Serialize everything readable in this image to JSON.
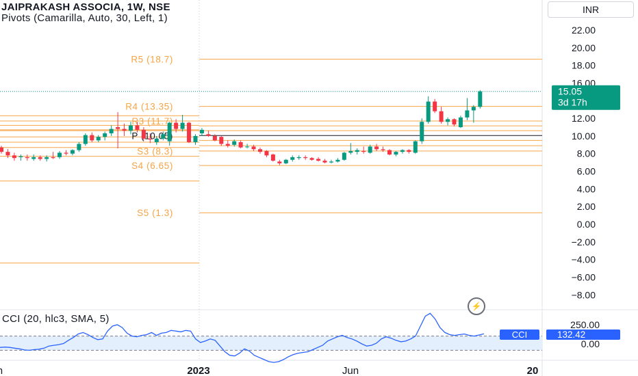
{
  "header": {
    "title": "JAIPRAKASH ASSOCIA, 1W, NSE",
    "subtitle": "Pivots (Camarilla, Auto, 30, Left, 1)",
    "currency": "INR"
  },
  "price_axis": {
    "ticks": [
      "22.00",
      "20.00",
      "18.00",
      "16.00",
      "14.00",
      "12.00",
      "10.00",
      "8.00",
      "6.00",
      "4.00",
      "2.00",
      "0.00",
      "−2.00",
      "−4.00",
      "−6.00",
      "−8.00"
    ],
    "last_price": "15.05",
    "countdown": "3d 17h",
    "last_color": "#089981"
  },
  "time_axis": {
    "labels": [
      "Jun",
      "2023",
      "Jun",
      "20"
    ]
  },
  "cci": {
    "title": "CCI (20, hlc3, SMA, 5)",
    "ticks": [
      "250.00",
      "0.00"
    ],
    "badge_label": "CCI",
    "badge_value": "132.42",
    "line_color": "#2962ff"
  },
  "flash_icon": "lightning-icon",
  "colors": {
    "up": "#089981",
    "down": "#f23645",
    "pivot": "#f7a446",
    "grid_text": "#131722"
  },
  "chart_data": {
    "type": "candlestick",
    "title": "JAIPRAKASH ASSOCIA, 1W, NSE",
    "ylim": [
      -9.2,
      23.6
    ],
    "pivot_levels_current": [
      {
        "label": "R5 (18.7)",
        "value": 18.7
      },
      {
        "label": "R4 (13.35)",
        "value": 13.35
      },
      {
        "label": "R3 (11.7)",
        "value": 11.7
      },
      {
        "label": "S4 (6.65)",
        "value": 6.65
      },
      {
        "label": "S3 (8.3)",
        "value": 8.3
      },
      {
        "label": "S5 (1.3)",
        "value": 1.3
      },
      {
        "label": "P (10.05)",
        "value": 10.05
      }
    ],
    "pivot_levels_current_unlabeled": [
      11.15,
      10.6,
      9.5,
      8.9
    ],
    "pivot_levels_previous": [
      12.3,
      11.7,
      11.2,
      10.6,
      10.7,
      9.9,
      9.3,
      8.7,
      7.7,
      4.9,
      -4.4
    ],
    "candles": [
      {
        "o": 8.7,
        "h": 8.9,
        "l": 8.0,
        "c": 8.2
      },
      {
        "o": 8.2,
        "h": 8.5,
        "l": 7.5,
        "c": 7.8
      },
      {
        "o": 7.8,
        "h": 8.1,
        "l": 7.2,
        "c": 7.5
      },
      {
        "o": 7.6,
        "h": 7.9,
        "l": 7.2,
        "c": 7.7
      },
      {
        "o": 7.6,
        "h": 7.9,
        "l": 7.2,
        "c": 7.5
      },
      {
        "o": 7.4,
        "h": 7.9,
        "l": 7.2,
        "c": 7.6
      },
      {
        "o": 7.6,
        "h": 7.8,
        "l": 7.2,
        "c": 7.4
      },
      {
        "o": 7.4,
        "h": 7.8,
        "l": 7.1,
        "c": 7.6
      },
      {
        "o": 7.6,
        "h": 8.2,
        "l": 7.4,
        "c": 7.5
      },
      {
        "o": 7.6,
        "h": 8.3,
        "l": 7.4,
        "c": 8.1
      },
      {
        "o": 8.1,
        "h": 8.4,
        "l": 7.8,
        "c": 8.0
      },
      {
        "o": 8.0,
        "h": 8.5,
        "l": 7.8,
        "c": 8.4
      },
      {
        "o": 8.4,
        "h": 9.3,
        "l": 8.2,
        "c": 9.1
      },
      {
        "o": 9.1,
        "h": 10.3,
        "l": 8.9,
        "c": 10.1
      },
      {
        "o": 10.1,
        "h": 10.4,
        "l": 9.3,
        "c": 9.5
      },
      {
        "o": 9.5,
        "h": 10.1,
        "l": 9.3,
        "c": 9.9
      },
      {
        "o": 9.9,
        "h": 10.5,
        "l": 9.5,
        "c": 10.3
      },
      {
        "o": 10.3,
        "h": 11.2,
        "l": 10.0,
        "c": 10.8
      },
      {
        "o": 11.0,
        "h": 12.7,
        "l": 8.6,
        "c": 10.8
      },
      {
        "o": 10.8,
        "h": 11.4,
        "l": 10.0,
        "c": 10.6
      },
      {
        "o": 10.6,
        "h": 11.6,
        "l": 10.2,
        "c": 11.2
      },
      {
        "o": 11.2,
        "h": 11.6,
        "l": 10.4,
        "c": 10.7
      },
      {
        "o": 10.7,
        "h": 11.0,
        "l": 9.5,
        "c": 9.7
      },
      {
        "o": 9.7,
        "h": 10.3,
        "l": 9.2,
        "c": 9.6
      },
      {
        "o": 9.3,
        "h": 10.0,
        "l": 9.0,
        "c": 9.7
      },
      {
        "o": 9.7,
        "h": 10.5,
        "l": 9.5,
        "c": 10.2
      },
      {
        "o": 9.4,
        "h": 11.6,
        "l": 8.9,
        "c": 11.5
      },
      {
        "o": 11.5,
        "h": 11.9,
        "l": 10.4,
        "c": 10.8
      },
      {
        "o": 10.8,
        "h": 12.4,
        "l": 10.5,
        "c": 11.5
      },
      {
        "o": 11.5,
        "h": 11.6,
        "l": 9.2,
        "c": 9.3
      },
      {
        "o": 9.3,
        "h": 10.2,
        "l": 9.0,
        "c": 10.0
      },
      {
        "o": 10.3,
        "h": 10.9,
        "l": 10.0,
        "c": 10.7
      },
      {
        "o": 10.2,
        "h": 10.6,
        "l": 9.9,
        "c": 10.0
      },
      {
        "o": 10.0,
        "h": 10.2,
        "l": 9.4,
        "c": 9.5
      },
      {
        "o": 9.9,
        "h": 10.0,
        "l": 8.9,
        "c": 9.1
      },
      {
        "o": 9.1,
        "h": 9.5,
        "l": 8.7,
        "c": 8.9
      },
      {
        "o": 9.0,
        "h": 9.6,
        "l": 8.8,
        "c": 9.4
      },
      {
        "o": 9.3,
        "h": 9.5,
        "l": 8.6,
        "c": 8.7
      },
      {
        "o": 8.8,
        "h": 9.1,
        "l": 8.6,
        "c": 8.8
      },
      {
        "o": 8.8,
        "h": 9.0,
        "l": 8.3,
        "c": 8.5
      },
      {
        "o": 8.5,
        "h": 8.7,
        "l": 8.0,
        "c": 8.2
      },
      {
        "o": 8.3,
        "h": 8.4,
        "l": 7.6,
        "c": 7.8
      },
      {
        "o": 7.9,
        "h": 8.0,
        "l": 7.1,
        "c": 7.2
      },
      {
        "o": 7.1,
        "h": 7.3,
        "l": 6.7,
        "c": 6.9
      },
      {
        "o": 6.9,
        "h": 7.4,
        "l": 6.8,
        "c": 7.3
      },
      {
        "o": 7.3,
        "h": 7.8,
        "l": 7.1,
        "c": 7.6
      },
      {
        "o": 7.5,
        "h": 7.8,
        "l": 7.3,
        "c": 7.6
      },
      {
        "o": 7.6,
        "h": 7.8,
        "l": 7.3,
        "c": 7.5
      },
      {
        "o": 7.5,
        "h": 7.6,
        "l": 7.2,
        "c": 7.3
      },
      {
        "o": 7.4,
        "h": 7.6,
        "l": 7.1,
        "c": 7.2
      },
      {
        "o": 7.2,
        "h": 7.4,
        "l": 6.9,
        "c": 7.0
      },
      {
        "o": 7.0,
        "h": 7.3,
        "l": 6.9,
        "c": 7.1
      },
      {
        "o": 7.1,
        "h": 7.5,
        "l": 7.0,
        "c": 7.3
      },
      {
        "o": 7.3,
        "h": 8.2,
        "l": 7.2,
        "c": 8.1
      },
      {
        "o": 8.1,
        "h": 9.2,
        "l": 7.9,
        "c": 8.3
      },
      {
        "o": 8.2,
        "h": 8.6,
        "l": 7.9,
        "c": 8.4
      },
      {
        "o": 8.3,
        "h": 8.8,
        "l": 8.0,
        "c": 8.2
      },
      {
        "o": 8.1,
        "h": 9.0,
        "l": 8.0,
        "c": 8.8
      },
      {
        "o": 8.8,
        "h": 9.1,
        "l": 8.3,
        "c": 8.5
      },
      {
        "o": 8.5,
        "h": 8.8,
        "l": 8.2,
        "c": 8.4
      },
      {
        "o": 8.4,
        "h": 8.5,
        "l": 7.8,
        "c": 7.9
      },
      {
        "o": 7.9,
        "h": 8.3,
        "l": 7.7,
        "c": 8.2
      },
      {
        "o": 8.2,
        "h": 8.5,
        "l": 8.0,
        "c": 8.4
      },
      {
        "o": 8.4,
        "h": 8.5,
        "l": 8.0,
        "c": 8.2
      },
      {
        "o": 8.1,
        "h": 9.5,
        "l": 8.0,
        "c": 9.4
      },
      {
        "o": 9.4,
        "h": 12.0,
        "l": 9.1,
        "c": 11.6
      },
      {
        "o": 11.6,
        "h": 14.5,
        "l": 11.4,
        "c": 13.9
      },
      {
        "o": 13.9,
        "h": 14.2,
        "l": 12.6,
        "c": 12.8
      },
      {
        "o": 12.8,
        "h": 13.3,
        "l": 11.4,
        "c": 11.6
      },
      {
        "o": 11.6,
        "h": 12.1,
        "l": 11.2,
        "c": 11.9
      },
      {
        "o": 11.9,
        "h": 12.0,
        "l": 11.1,
        "c": 11.3
      },
      {
        "o": 11.0,
        "h": 12.3,
        "l": 10.9,
        "c": 12.1
      },
      {
        "o": 12.1,
        "h": 14.3,
        "l": 11.8,
        "c": 12.9
      },
      {
        "o": 12.9,
        "h": 13.5,
        "l": 11.5,
        "c": 13.3
      },
      {
        "o": 13.3,
        "h": 15.2,
        "l": 13.1,
        "c": 15.05
      }
    ],
    "cci_ylim": [
      -120,
      330
    ],
    "cci_values": [
      -60,
      -55,
      -60,
      -70,
      -80,
      -95,
      -100,
      -90,
      -85,
      -70,
      -40,
      -30,
      -20,
      -5,
      40,
      80,
      130,
      150,
      120,
      80,
      50,
      60,
      170,
      240,
      260,
      220,
      140,
      100,
      90,
      110,
      120,
      150,
      110,
      140,
      150,
      180,
      170,
      160,
      180,
      170,
      60,
      10,
      30,
      60,
      40,
      -40,
      -120,
      -170,
      -180,
      -140,
      -80,
      -110,
      -170,
      -200,
      -230,
      -260,
      -270,
      -260,
      -230,
      -190,
      -160,
      -140,
      -130,
      -120,
      -90,
      -60,
      -30,
      30,
      60,
      90,
      110,
      80,
      60,
      30,
      -10,
      -40,
      -30,
      0,
      60,
      90,
      70,
      40,
      20,
      30,
      60,
      100,
      240,
      380,
      420,
      340,
      220,
      150,
      120,
      110,
      120,
      130,
      110,
      100,
      115,
      132
    ]
  }
}
